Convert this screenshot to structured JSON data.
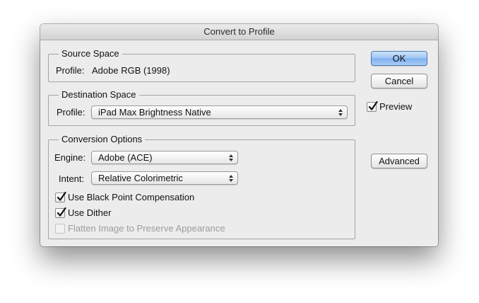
{
  "window": {
    "title": "Convert to Profile"
  },
  "source_space": {
    "legend": "Source Space",
    "profile_label": "Profile:",
    "profile_value": "Adobe RGB (1998)"
  },
  "destination_space": {
    "legend": "Destination Space",
    "profile_label": "Profile:",
    "profile_value": "iPad Max Brightness Native"
  },
  "conversion_options": {
    "legend": "Conversion Options",
    "engine_label": "Engine:",
    "engine_value": "Adobe (ACE)",
    "intent_label": "Intent:",
    "intent_value": "Relative Colorimetric",
    "black_point": {
      "label": "Use Black Point Compensation",
      "checked": true
    },
    "dither": {
      "label": "Use Dither",
      "checked": true
    },
    "flatten": {
      "label": "Flatten Image to Preserve Appearance",
      "checked": false,
      "enabled": false
    }
  },
  "buttons": {
    "ok": "OK",
    "cancel": "Cancel",
    "advanced": "Advanced"
  },
  "preview": {
    "label": "Preview",
    "checked": true
  },
  "colors": {
    "dialog_bg": "#ececec",
    "default_button": "#9cc3f3",
    "checkmark": "#111111",
    "disabled_text": "#9c9c9c"
  }
}
